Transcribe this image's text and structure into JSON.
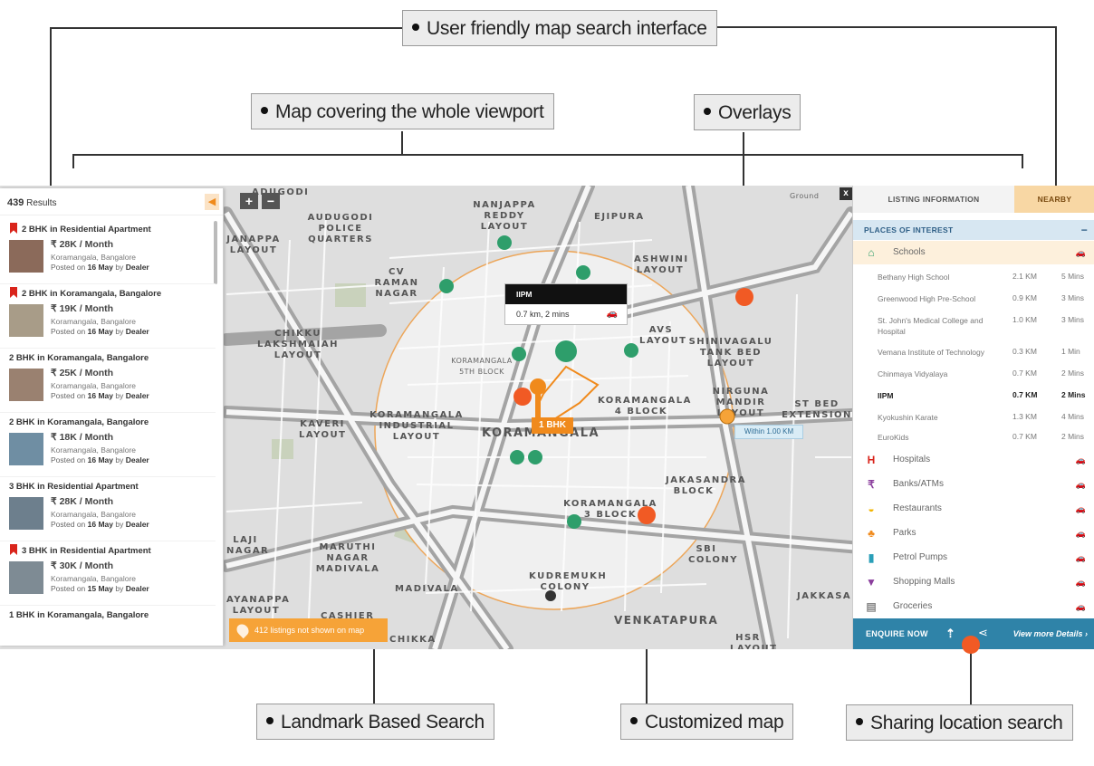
{
  "callouts": {
    "top": "User friendly map search interface",
    "map": "Map covering the whole viewport",
    "overlays": "Overlays",
    "landmark": "Landmark Based Search",
    "customized": "Customized map",
    "sharing": "Sharing location search"
  },
  "results_panel": {
    "count": "439",
    "count_label": "Results",
    "listings": [
      {
        "title": "2 BHK in Residential Apartment",
        "flag": true,
        "price": "₹ 28K / Month",
        "location": "Koramangala, Bangalore",
        "posted_prefix": "Posted on",
        "date": "16 May",
        "by": "by",
        "poster": "Dealer"
      },
      {
        "title": "2 BHK in Koramangala, Bangalore",
        "flag": true,
        "price": "₹ 19K / Month",
        "location": "Koramangala, Bangalore",
        "posted_prefix": "Posted on",
        "date": "16 May",
        "by": "by",
        "poster": "Dealer"
      },
      {
        "title": "2 BHK in Koramangala, Bangalore",
        "flag": false,
        "price": "₹ 25K / Month",
        "location": "Koramangala, Bangalore",
        "posted_prefix": "Posted on",
        "date": "16 May",
        "by": "by",
        "poster": "Dealer"
      },
      {
        "title": "2 BHK in Koramangala, Bangalore",
        "flag": false,
        "price": "₹ 18K / Month",
        "location": "Koramangala, Bangalore",
        "posted_prefix": "Posted on",
        "date": "16 May",
        "by": "by",
        "poster": "Dealer"
      },
      {
        "title": "3 BHK in Residential Apartment",
        "flag": false,
        "price": "₹ 28K / Month",
        "location": "Koramangala, Bangalore",
        "posted_prefix": "Posted on",
        "date": "16 May",
        "by": "by",
        "poster": "Dealer"
      },
      {
        "title": "3 BHK in Residential Apartment",
        "flag": true,
        "price": "₹ 30K / Month",
        "location": "Koramangala, Bangalore",
        "posted_prefix": "Posted on",
        "date": "15 May",
        "by": "by",
        "poster": "Dealer"
      },
      {
        "title": "1 BHK in Koramangala, Bangalore",
        "flag": false,
        "price": "",
        "location": "",
        "posted_prefix": "",
        "date": "",
        "by": "",
        "poster": ""
      }
    ]
  },
  "map": {
    "zoom_in": "+",
    "zoom_out": "−",
    "close": "x",
    "popup_title": "IIPM",
    "popup_info": "0.7 km, 2 mins",
    "within_badge": "Within 1.00 KM",
    "pin_label": "1 BHK",
    "listings_pill": "412 listings not shown on map",
    "labels": [
      "ADUGODI",
      "AUDUGODI POLICE QUARTERS",
      "NANJAPPA REDDY LAYOUT",
      "EJIPURA",
      "ASHWINI LAYOUT",
      "CV RAMAN NAGAR",
      "CHIKKU LAKSHMAIAH LAYOUT",
      "KORAMANGALA 5TH BLOCK",
      "AVS LAYOUT",
      "SHINIVAGALU TANK BED LAYOUT",
      "NIRGUNA MANDIR LAYOUT",
      "ST BED EXTENSION",
      "KORAMANGALA INDUSTRIAL LAYOUT",
      "KORAMANGALA 4 BLOCK",
      "KAVERI LAYOUT",
      "KORAMANGALA",
      "JAKASANDRA BLOCK",
      "KORAMANGALA 3 BLOCK",
      "MARUTHI NAGAR MADIVALA",
      "MADIVALA",
      "KUDREMUKH COLONY",
      "SBI COLONY",
      "JAKKASA",
      "VENKATAPURA",
      "HSR LAYOUT",
      "CHIKKA",
      "CASHIER",
      "LAJI NAGAR",
      "AYANAPPA LAYOUT",
      "JANAPPA LAYOUT",
      "Ground"
    ]
  },
  "info_panel": {
    "tab_listing": "LISTING INFORMATION",
    "tab_nearby": "NEARBY",
    "section": "PLACES OF INTEREST",
    "section_toggle": "−",
    "schools_label": "Schools",
    "schools": [
      {
        "name": "Bethany High School",
        "dist": "2.1 KM",
        "time": "5 Mins"
      },
      {
        "name": "Greenwood High Pre-School",
        "dist": "0.9 KM",
        "time": "3 Mins"
      },
      {
        "name": "St. John's Medical College and Hospital",
        "dist": "1.0 KM",
        "time": "3 Mins"
      },
      {
        "name": "Vemana Institute of Technology",
        "dist": "0.3 KM",
        "time": "1 Min"
      },
      {
        "name": "Chinmaya Vidyalaya",
        "dist": "0.7 KM",
        "time": "2 Mins"
      },
      {
        "name": "IIPM",
        "dist": "0.7 KM",
        "time": "2 Mins"
      },
      {
        "name": "Kyokushin Karate",
        "dist": "1.3 KM",
        "time": "4 Mins"
      },
      {
        "name": "EuroKids",
        "dist": "0.7 KM",
        "time": "2 Mins"
      }
    ],
    "categories": [
      "Hospitals",
      "Banks/ATMs",
      "Restaurants",
      "Parks",
      "Petrol Pumps",
      "Shopping Malls",
      "Groceries"
    ],
    "enquire": "ENQUIRE NOW",
    "view_more": "View more Details",
    "accent": "#f15a24"
  }
}
